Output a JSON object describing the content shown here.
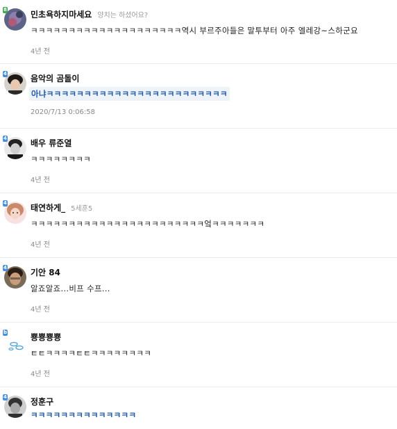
{
  "comments": [
    {
      "nick": "민초욕하지마세요",
      "sub": "양치는 하셨어요?",
      "text": "ㅋㅋㅋㅋㅋㅋㅋㅋㅋㅋㅋㅋㅋㅋㅋㅋㅋㅋㅋㅋ역시 부르주아들은 말투부터 아주 엘레강~스하군요",
      "time": "4년 전",
      "badge": "8",
      "avatar_color": "#6b6f8f"
    },
    {
      "nick": "음악의 곰돌이",
      "sub": "",
      "text": "아냐ㅋㅋㅋㅋㅋㅋㅋㅋㅋㅋㅋㅋㅋㅋㅋㅋㅋㅋㅋㅋㅋㅋㅋㅋ",
      "time": "2020/7/13 0:06:58",
      "badge": "4",
      "avatar_color": "#2d2a2a"
    },
    {
      "nick": "배우 류준열",
      "sub": "",
      "text": "ㅋㅋㅋㅋㅋㅋㅋㅋ",
      "time": "4년 전",
      "badge": "4",
      "avatar_color": "#3b3b3b"
    },
    {
      "nick": "태연하게_",
      "sub": "5세훈5",
      "text": "ㅋㅋㅋㅋㅋㅋㅋㅋㅋㅋㅋㅋㅋㅋㅋㅋㅋㅋㅋㅋㅋㅋㅋ엌ㅋㅋㅋㅋㅋㅋㅋ",
      "time": "4년 전",
      "badge": "4",
      "avatar_color": "#f1c6c6"
    },
    {
      "nick": "기안 84",
      "sub": "",
      "text": "알죠알죠...비프 수프...",
      "time": "4년 전",
      "badge": "4",
      "avatar_color": "#4a3a2a"
    },
    {
      "nick": "뿅뿅뿅뿅",
      "sub": "",
      "text": "ㅌㅌㅋㅋㅋㅋㅌㅌㅋㅋㅋㅋㅋㅋㅋㅋ",
      "time": "4년 전",
      "badge": "b",
      "avatar_color": "#ffffff"
    },
    {
      "nick": "정훈구",
      "sub": "",
      "text": "ㅋㅋㅋㅋㅋㅋㅋㅋㅋㅋㅋㅋㅋㅋ",
      "time": "",
      "badge": "4",
      "avatar_color": "#5a5a5a"
    }
  ]
}
